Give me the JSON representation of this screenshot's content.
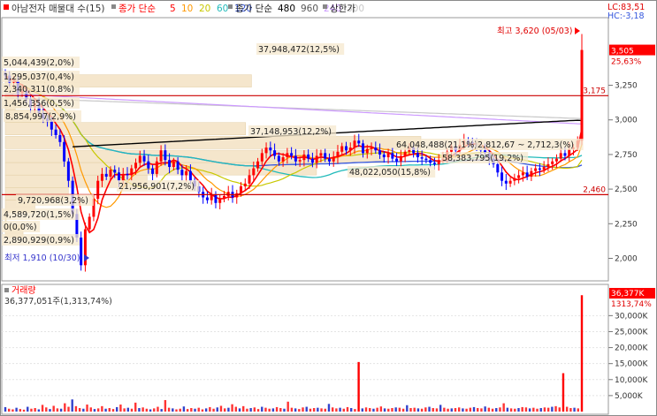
{
  "toolbar": {
    "title": "아남전자 매물대 수(15)",
    "ma_group_a_label": "종가 단순",
    "ma_group_a_periods": [
      "5",
      "10",
      "20",
      "60",
      "120"
    ],
    "ma_group_b_label": "종가 단순",
    "ma_group_b_periods": [
      "480",
      "960",
      "240",
      "300"
    ],
    "limit_label": "상한가",
    "lc_readout": "LC:83,51",
    "hc_readout": "HC:-3,18",
    "colors": {
      "ma5": "#ff0000",
      "ma10": "#ff9900",
      "ma20": "#c8c800",
      "ma60": "#22bbbb",
      "ma120": "#3355dd",
      "ma480": "#000000",
      "ma960": "#555555",
      "ma240": "#cc99ff",
      "ma300": "#c8c8c8",
      "up": "#ff0000",
      "down": "#0000ff"
    }
  },
  "price_panel": {
    "current_price_badge": "3,505",
    "current_change_pct": "25,63%",
    "high_annotation": "최고 3,620 (05/03)",
    "low_annotation": "최저 1,910 (10/30)",
    "line_upper_label": "3,175",
    "line_lower_label": "2,460",
    "y_ticks": [
      "3,250",
      "3,000",
      "2,750",
      "2,500",
      "2,250",
      "2,000"
    ],
    "profile_labels": [
      "37,948,472(12,5%)",
      "5,044,439(2,0%)",
      "1,295,037(0,4%)",
      "2,340,311(0,8%)",
      "1,456,356(0,5%)",
      "8,854,997(2,9%)",
      "37,148,953(12,2%)",
      "64,048,488(21,1%)",
      "2,812,67 ~ 2,712,3(%)",
      "58,383,795(19,2%)",
      "48,022,050(15,8%)",
      "21,956,901(7,2%)",
      "9,720,968(3,2%)",
      "4,589,720(1,5%)",
      "0(0,0%)",
      "2,890,929(0,9%)"
    ]
  },
  "volume_panel": {
    "title": "거래량",
    "value_readout": "36,377,051주(1,313,74%)",
    "badge_value": "36,377K",
    "badge_pct": "1313,74%",
    "y_ticks": [
      "30,000K",
      "25,000K",
      "20,000K",
      "15,000K",
      "10,000K",
      "5,000K"
    ]
  },
  "chart_data": [
    {
      "type": "candlestick",
      "title": "아남전자 매물대 수(15)",
      "ylim": [
        1850,
        3700
      ],
      "y_ticks": [
        2000,
        2250,
        2500,
        2750,
        3000,
        3250
      ],
      "last_price": 3505,
      "change_pct": 25.63,
      "high": {
        "value": 3620,
        "date": "05/03"
      },
      "low": {
        "value": 1910,
        "date": "10/30"
      },
      "horizontal_lines": [
        3175,
        2460
      ],
      "volume_profile": [
        {
          "volume": 37948472,
          "pct": 12.5
        },
        {
          "volume": 5044439,
          "pct": 2.0
        },
        {
          "volume": 1295037,
          "pct": 0.4
        },
        {
          "volume": 2340311,
          "pct": 0.8
        },
        {
          "volume": 1456356,
          "pct": 0.5
        },
        {
          "volume": 8854997,
          "pct": 2.9
        },
        {
          "volume": 37148953,
          "pct": 12.2
        },
        {
          "volume": 64048488,
          "pct": 21.1
        },
        {
          "volume": 58383795,
          "pct": 19.2
        },
        {
          "volume": 48022050,
          "pct": 15.8
        },
        {
          "volume": 21956901,
          "pct": 7.2
        },
        {
          "volume": 9720968,
          "pct": 3.2
        },
        {
          "volume": 4589720,
          "pct": 1.5
        },
        {
          "volume": 0,
          "pct": 0.0
        },
        {
          "volume": 2890929,
          "pct": 0.9
        }
      ],
      "closes": [
        3320,
        3270,
        3280,
        3190,
        3210,
        3150,
        3090,
        3120,
        3050,
        3010,
        2990,
        2930,
        2890,
        2840,
        2700,
        2560,
        2320,
        2150,
        1950,
        2210,
        2300,
        2430,
        2560,
        2610,
        2590,
        2640,
        2620,
        2560,
        2610,
        2600,
        2650,
        2690,
        2740,
        2700,
        2650,
        2610,
        2700,
        2780,
        2710,
        2660,
        2700,
        2640,
        2600,
        2630,
        2560,
        2520,
        2480,
        2440,
        2420,
        2460,
        2400,
        2430,
        2450,
        2480,
        2440,
        2470,
        2520,
        2540,
        2600,
        2650,
        2700,
        2760,
        2800,
        2780,
        2740,
        2700,
        2730,
        2760,
        2740,
        2700,
        2710,
        2750,
        2720,
        2690,
        2740,
        2760,
        2720,
        2700,
        2730,
        2770,
        2810,
        2780,
        2800,
        2850,
        2830,
        2760,
        2790,
        2800,
        2780,
        2750,
        2730,
        2760,
        2720,
        2700,
        2740,
        2770,
        2800,
        2760,
        2730,
        2720,
        2710,
        2690,
        2680,
        2710,
        2720,
        2770,
        2810,
        2780,
        2820,
        2850,
        2840,
        2830,
        2800,
        2780,
        2760,
        2720,
        2680,
        2620,
        2560,
        2540,
        2560,
        2580,
        2600,
        2620,
        2590,
        2630,
        2650,
        2640,
        2660,
        2680,
        2700,
        2720,
        2760,
        2740,
        2790,
        2800,
        2850,
        3505
      ],
      "series": [
        {
          "name": "5"
        },
        {
          "name": "10"
        },
        {
          "name": "20"
        },
        {
          "name": "60"
        },
        {
          "name": "120"
        },
        {
          "name": "480"
        },
        {
          "name": "960"
        },
        {
          "name": "240"
        },
        {
          "name": "300"
        }
      ]
    },
    {
      "type": "bar",
      "title": "거래량",
      "ylim": [
        0,
        37000
      ],
      "y_ticks": [
        5000,
        10000,
        15000,
        20000,
        25000,
        30000
      ],
      "unit": "K",
      "last_volume": 36377051,
      "last_volume_pct": 1313.74,
      "spikes": [
        {
          "index": 95,
          "value": 15500
        },
        {
          "index": 152,
          "value": 12000
        },
        {
          "index": 157,
          "value": 36377
        }
      ],
      "base_volumes": [
        1400,
        900,
        700,
        1200,
        800,
        600,
        1500,
        900,
        1100,
        700,
        2100,
        1300,
        800,
        1800,
        1000,
        900,
        2600,
        1500,
        3800,
        1700,
        1100,
        900,
        2200,
        1300,
        800,
        1000,
        1700,
        900,
        1100,
        800,
        1400,
        2200,
        1000,
        1200,
        900,
        2800,
        1100,
        1300,
        900,
        700,
        1000,
        1500,
        800,
        3600,
        1200,
        1000,
        700,
        900,
        1600,
        800,
        1100,
        900,
        1200,
        700,
        1000,
        1400,
        900,
        1300,
        1800,
        1000,
        1200,
        2300,
        1500,
        1000,
        1700,
        900,
        1100,
        1300,
        800,
        1500,
        1200,
        900,
        1000,
        1400,
        1100,
        900,
        3100,
        1200,
        1000,
        800,
        1300,
        1500,
        900,
        1100,
        1200,
        1000,
        900,
        2400,
        1300,
        1000,
        1200,
        900,
        1400,
        1100,
        800,
        15500,
        1000,
        1300,
        1100,
        900,
        1200,
        1600,
        1000,
        900,
        1100,
        1300,
        1200,
        900,
        2000,
        1100,
        1200,
        1000,
        900,
        1300,
        1500,
        1100,
        1000,
        2100,
        1200,
        900,
        1000,
        1100,
        1300,
        1000,
        900,
        1200,
        1400,
        1100,
        1000,
        1600,
        1200,
        900,
        1100,
        1300,
        2600,
        1200,
        1000,
        900,
        1100,
        1400,
        1300,
        1000,
        1200,
        900,
        1100,
        1300,
        1200,
        1500,
        1700,
        1300,
        12000,
        1500,
        1100,
        1200,
        1000,
        36377
      ]
    }
  ]
}
